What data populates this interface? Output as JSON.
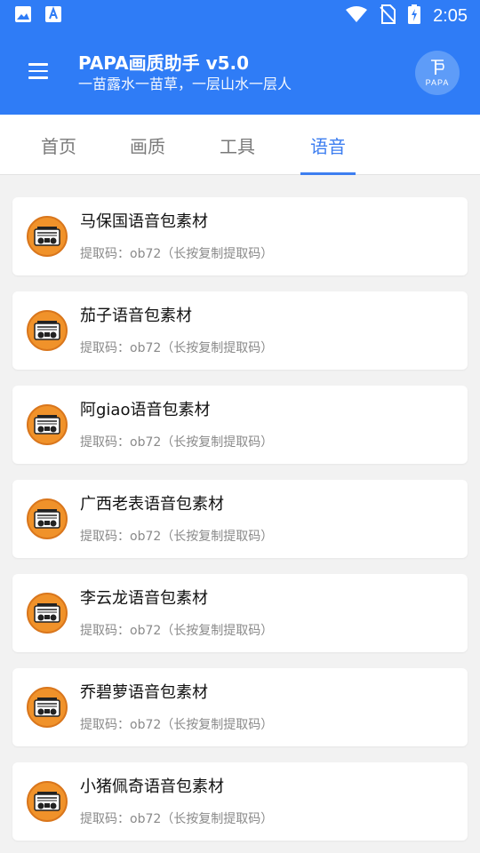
{
  "status_bar": {
    "time": "2:05",
    "left_icons": [
      "image-icon",
      "app-store-icon"
    ],
    "right_icons": [
      "wifi-icon",
      "no-sim-icon",
      "battery-charging-icon"
    ]
  },
  "app_bar": {
    "title": "PAPA画质助手 v5.0",
    "subtitle": "一苗露水一苗草，一层山水一层人",
    "logo_text": "PAPA",
    "accent_color": "#2f7cf6"
  },
  "tabs": [
    {
      "label": "首页",
      "active": false
    },
    {
      "label": "画质",
      "active": false
    },
    {
      "label": "工具",
      "active": false
    },
    {
      "label": "语音",
      "active": true
    }
  ],
  "items": [
    {
      "title": "马保国语音包素材",
      "subtitle": "提取码：ob72（长按复制提取码）",
      "icon": "radio-icon"
    },
    {
      "title": "茄子语音包素材",
      "subtitle": "提取码：ob72（长按复制提取码）",
      "icon": "radio-icon"
    },
    {
      "title": "阿giao语音包素材",
      "subtitle": "提取码：ob72（长按复制提取码）",
      "icon": "radio-icon"
    },
    {
      "title": "广西老表语音包素材",
      "subtitle": "提取码：ob72（长按复制提取码）",
      "icon": "radio-icon"
    },
    {
      "title": "李云龙语音包素材",
      "subtitle": "提取码：ob72（长按复制提取码）",
      "icon": "radio-icon"
    },
    {
      "title": "乔碧萝语音包素材",
      "subtitle": "提取码：ob72（长按复制提取码）",
      "icon": "radio-icon"
    },
    {
      "title": "小猪佩奇语音包素材",
      "subtitle": "提取码：ob72（长按复制提取码）",
      "icon": "radio-icon"
    }
  ]
}
